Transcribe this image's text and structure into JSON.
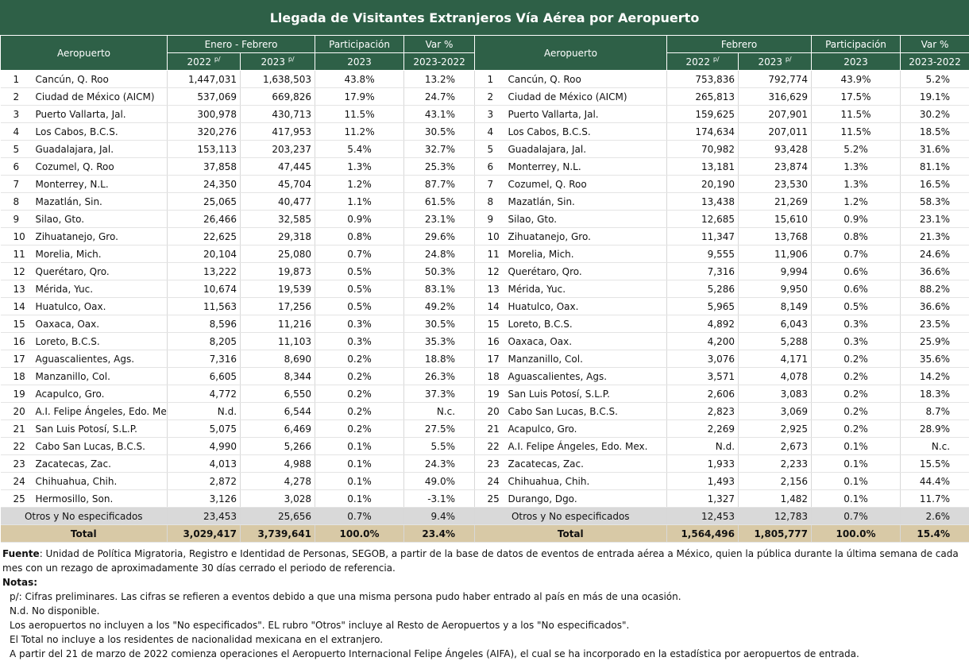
{
  "title": "Llegada de Visitantes Extranjeros Vía Aérea por Aeropuerto",
  "left": {
    "headers": {
      "aeropuerto": "Aeropuerto",
      "period": "Enero - Febrero",
      "participacion": "Participación",
      "var": "Var %",
      "y2022": "2022",
      "y2023": "2023",
      "prelim": "p/",
      "part_year": "2023",
      "var_years": "2023-2022"
    },
    "rows": [
      [
        "1",
        "Cancún, Q. Roo",
        "1,447,031",
        "1,638,503",
        "43.8%",
        "13.2%"
      ],
      [
        "2",
        "Ciudad de México (AICM)",
        "537,069",
        "669,826",
        "17.9%",
        "24.7%"
      ],
      [
        "3",
        "Puerto Vallarta, Jal.",
        "300,978",
        "430,713",
        "11.5%",
        "43.1%"
      ],
      [
        "4",
        "Los Cabos, B.C.S.",
        "320,276",
        "417,953",
        "11.2%",
        "30.5%"
      ],
      [
        "5",
        "Guadalajara, Jal.",
        "153,113",
        "203,237",
        "5.4%",
        "32.7%"
      ],
      [
        "6",
        "Cozumel, Q. Roo",
        "37,858",
        "47,445",
        "1.3%",
        "25.3%"
      ],
      [
        "7",
        "Monterrey, N.L.",
        "24,350",
        "45,704",
        "1.2%",
        "87.7%"
      ],
      [
        "8",
        "Mazatlán, Sin.",
        "25,065",
        "40,477",
        "1.1%",
        "61.5%"
      ],
      [
        "9",
        "Silao, Gto.",
        "26,466",
        "32,585",
        "0.9%",
        "23.1%"
      ],
      [
        "10",
        "Zihuatanejo, Gro.",
        "22,625",
        "29,318",
        "0.8%",
        "29.6%"
      ],
      [
        "11",
        "Morelia, Mich.",
        "20,104",
        "25,080",
        "0.7%",
        "24.8%"
      ],
      [
        "12",
        "Querétaro, Qro.",
        "13,222",
        "19,873",
        "0.5%",
        "50.3%"
      ],
      [
        "13",
        "Mérida, Yuc.",
        "10,674",
        "19,539",
        "0.5%",
        "83.1%"
      ],
      [
        "14",
        "Huatulco, Oax.",
        "11,563",
        "17,256",
        "0.5%",
        "49.2%"
      ],
      [
        "15",
        "Oaxaca, Oax.",
        "8,596",
        "11,216",
        "0.3%",
        "30.5%"
      ],
      [
        "16",
        "Loreto, B.C.S.",
        "8,205",
        "11,103",
        "0.3%",
        "35.3%"
      ],
      [
        "17",
        "Aguascalientes, Ags.",
        "7,316",
        "8,690",
        "0.2%",
        "18.8%"
      ],
      [
        "18",
        "Manzanillo, Col.",
        "6,605",
        "8,344",
        "0.2%",
        "26.3%"
      ],
      [
        "19",
        "Acapulco, Gro.",
        "4,772",
        "6,550",
        "0.2%",
        "37.3%"
      ],
      [
        "20",
        "A.I. Felipe Ángeles, Edo. Mex",
        "N.d.",
        "6,544",
        "0.2%",
        "N.c."
      ],
      [
        "21",
        "San Luis Potosí, S.L.P.",
        "5,075",
        "6,469",
        "0.2%",
        "27.5%"
      ],
      [
        "22",
        "Cabo San Lucas, B.C.S.",
        "4,990",
        "5,266",
        "0.1%",
        "5.5%"
      ],
      [
        "23",
        "Zacatecas, Zac.",
        "4,013",
        "4,988",
        "0.1%",
        "24.3%"
      ],
      [
        "24",
        "Chihuahua, Chih.",
        "2,872",
        "4,278",
        "0.1%",
        "49.0%"
      ],
      [
        "25",
        "Hermosillo, Son.",
        "3,126",
        "3,028",
        "0.1%",
        "-3.1%"
      ]
    ],
    "otros": [
      "Otros y No especificados",
      "23,453",
      "25,656",
      "0.7%",
      "9.4%"
    ],
    "total": [
      "Total",
      "3,029,417",
      "3,739,641",
      "100.0%",
      "23.4%"
    ]
  },
  "right": {
    "headers": {
      "aeropuerto": "Aeropuerto",
      "period": "Febrero",
      "participacion": "Participación",
      "var": "Var %",
      "y2022": "2022",
      "y2023": "2023",
      "prelim": "p/",
      "part_year": "2023",
      "var_years": "2023-2022"
    },
    "rows": [
      [
        "1",
        "Cancún, Q. Roo",
        "753,836",
        "792,774",
        "43.9%",
        "5.2%"
      ],
      [
        "2",
        "Ciudad de México (AICM)",
        "265,813",
        "316,629",
        "17.5%",
        "19.1%"
      ],
      [
        "3",
        "Puerto Vallarta, Jal.",
        "159,625",
        "207,901",
        "11.5%",
        "30.2%"
      ],
      [
        "4",
        "Los Cabos, B.C.S.",
        "174,634",
        "207,011",
        "11.5%",
        "18.5%"
      ],
      [
        "5",
        "Guadalajara, Jal.",
        "70,982",
        "93,428",
        "5.2%",
        "31.6%"
      ],
      [
        "6",
        "Monterrey, N.L.",
        "13,181",
        "23,874",
        "1.3%",
        "81.1%"
      ],
      [
        "7",
        "Cozumel, Q. Roo",
        "20,190",
        "23,530",
        "1.3%",
        "16.5%"
      ],
      [
        "8",
        "Mazatlán, Sin.",
        "13,438",
        "21,269",
        "1.2%",
        "58.3%"
      ],
      [
        "9",
        "Silao, Gto.",
        "12,685",
        "15,610",
        "0.9%",
        "23.1%"
      ],
      [
        "10",
        "Zihuatanejo, Gro.",
        "11,347",
        "13,768",
        "0.8%",
        "21.3%"
      ],
      [
        "11",
        "Morelia, Mich.",
        "9,555",
        "11,906",
        "0.7%",
        "24.6%"
      ],
      [
        "12",
        "Querétaro, Qro.",
        "7,316",
        "9,994",
        "0.6%",
        "36.6%"
      ],
      [
        "13",
        "Mérida, Yuc.",
        "5,286",
        "9,950",
        "0.6%",
        "88.2%"
      ],
      [
        "14",
        "Huatulco, Oax.",
        "5,965",
        "8,149",
        "0.5%",
        "36.6%"
      ],
      [
        "15",
        "Loreto, B.C.S.",
        "4,892",
        "6,043",
        "0.3%",
        "23.5%"
      ],
      [
        "16",
        "Oaxaca, Oax.",
        "4,200",
        "5,288",
        "0.3%",
        "25.9%"
      ],
      [
        "17",
        "Manzanillo, Col.",
        "3,076",
        "4,171",
        "0.2%",
        "35.6%"
      ],
      [
        "18",
        "Aguascalientes, Ags.",
        "3,571",
        "4,078",
        "0.2%",
        "14.2%"
      ],
      [
        "19",
        "San Luis Potosí, S.L.P.",
        "2,606",
        "3,083",
        "0.2%",
        "18.3%"
      ],
      [
        "20",
        "Cabo San Lucas, B.C.S.",
        "2,823",
        "3,069",
        "0.2%",
        "8.7%"
      ],
      [
        "21",
        "Acapulco, Gro.",
        "2,269",
        "2,925",
        "0.2%",
        "28.9%"
      ],
      [
        "22",
        "A.I. Felipe Ángeles, Edo. Mex.",
        "N.d.",
        "2,673",
        "0.1%",
        "N.c."
      ],
      [
        "23",
        "Zacatecas, Zac.",
        "1,933",
        "2,233",
        "0.1%",
        "15.5%"
      ],
      [
        "24",
        "Chihuahua, Chih.",
        "1,493",
        "2,156",
        "0.1%",
        "44.4%"
      ],
      [
        "25",
        "Durango, Dgo.",
        "1,327",
        "1,482",
        "0.1%",
        "11.7%"
      ]
    ],
    "otros": [
      "Otros y No especificados",
      "12,453",
      "12,783",
      "0.7%",
      "2.6%"
    ],
    "total": [
      "Total",
      "1,564,496",
      "1,805,777",
      "100.0%",
      "15.4%"
    ]
  },
  "notes": {
    "fuente_label": "Fuente",
    "fuente_text": ": Unidad de Política Migratoria, Registro e Identidad de Personas, SEGOB, a partir de la base de datos de eventos de entrada aérea a México, quien la pública durante la última semana de cada mes con un rezago de aproximadamente 30 días cerrado el periodo de referencia.",
    "notas_label": "Notas:",
    "lines": [
      "p/: Cifras preliminares.   Las cifras se refieren a eventos debido a que una misma persona pudo haber entrado al país en más de una ocasión.",
      "N.d. No disponible.",
      "Los aeropuertos no incluyen a los \"No especificados\".   EL rubro \"Otros\" incluye al Resto de Aeropuertos y a los \"No especificados\".",
      "El Total no incluye a los residentes de nacionalidad mexicana en el extranjero.",
      "A partir del 21 de marzo de 2022 comienza operaciones el Aeropuerto Internacional Felipe Ángeles (AIFA), el cual se ha incorporado en la estadística por aeropuertos de entrada."
    ]
  }
}
